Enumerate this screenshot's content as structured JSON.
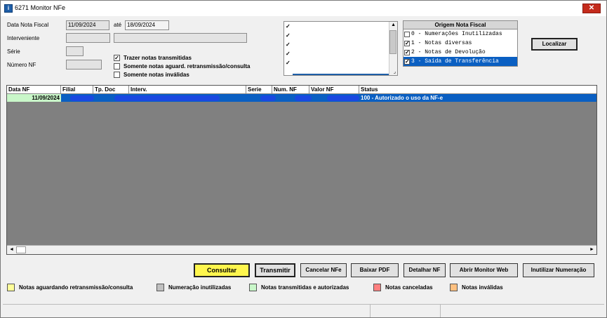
{
  "window": {
    "title": "6271 Monitor NFe",
    "close_symbol": "✕",
    "icon_letter": "i"
  },
  "filters": {
    "data_label": "Data Nota Fiscal",
    "data_from": "11/09/2024",
    "ate_label": "até",
    "data_to": "18/09/2024",
    "interveniente_label": "Interveniente",
    "interveniente_code": "",
    "interveniente_name": "",
    "serie_label": "Série",
    "serie_value": "",
    "numero_label": "Número NF",
    "numero_value": ""
  },
  "options": {
    "trazer_transmitidas": {
      "label": "Trazer notas transmitidas",
      "checked": "✓"
    },
    "somente_aguard": {
      "label": "Somente notas aguard. retransmissão/consulta",
      "checked": ""
    },
    "somente_invalidas": {
      "label": "Somente notas inválidas",
      "checked": ""
    }
  },
  "listbox": {
    "marks": [
      "✓",
      "✓",
      "✓",
      "✓",
      "✓"
    ],
    "up_arrow": "▲",
    "corner": "⌟"
  },
  "origem": {
    "title": "Origem Nota Fiscal",
    "items": [
      {
        "label": "0 - Numerações Inutilizadas",
        "checked": ""
      },
      {
        "label": "1 - Notas diversas",
        "checked": "✓"
      },
      {
        "label": "2 - Notas de Devolução",
        "checked": "✓"
      },
      {
        "label": "3 - Saída de Transferência",
        "checked": "✓"
      }
    ]
  },
  "localizar_button": "Localizar",
  "grid": {
    "columns": [
      "Data NF",
      "Filial",
      "Tp. Doc",
      "Interv.",
      "Serie",
      "Num. NF",
      "Valor NF",
      "Status"
    ],
    "rows": [
      {
        "data_nf": "11/09/2024",
        "status": "100 - Autorizado o uso da NF-e"
      }
    ],
    "scroll_left": "◄",
    "scroll_right": "►"
  },
  "buttons": {
    "consultar": "Consultar",
    "transmitir": "Transmitir",
    "cancelar": "Cancelar NFe",
    "baixar_pdf": "Baixar PDF",
    "detalhar": "Detalhar NF",
    "abrir_monitor": "Abrir Monitor Web",
    "inutilizar": "Inutilizar Numeração"
  },
  "legend": [
    {
      "label": "Notas aguardando retransmissão/consulta",
      "color": "#ffff99"
    },
    {
      "label": "Numeração inutilizadas",
      "color": "#c0c0c0"
    },
    {
      "label": "Notas transmitidas e autorizadas",
      "color": "#c9f7c9"
    },
    {
      "label": "Notas canceladas",
      "color": "#ff8080"
    },
    {
      "label": "Notas inválidas",
      "color": "#ffc080"
    }
  ]
}
